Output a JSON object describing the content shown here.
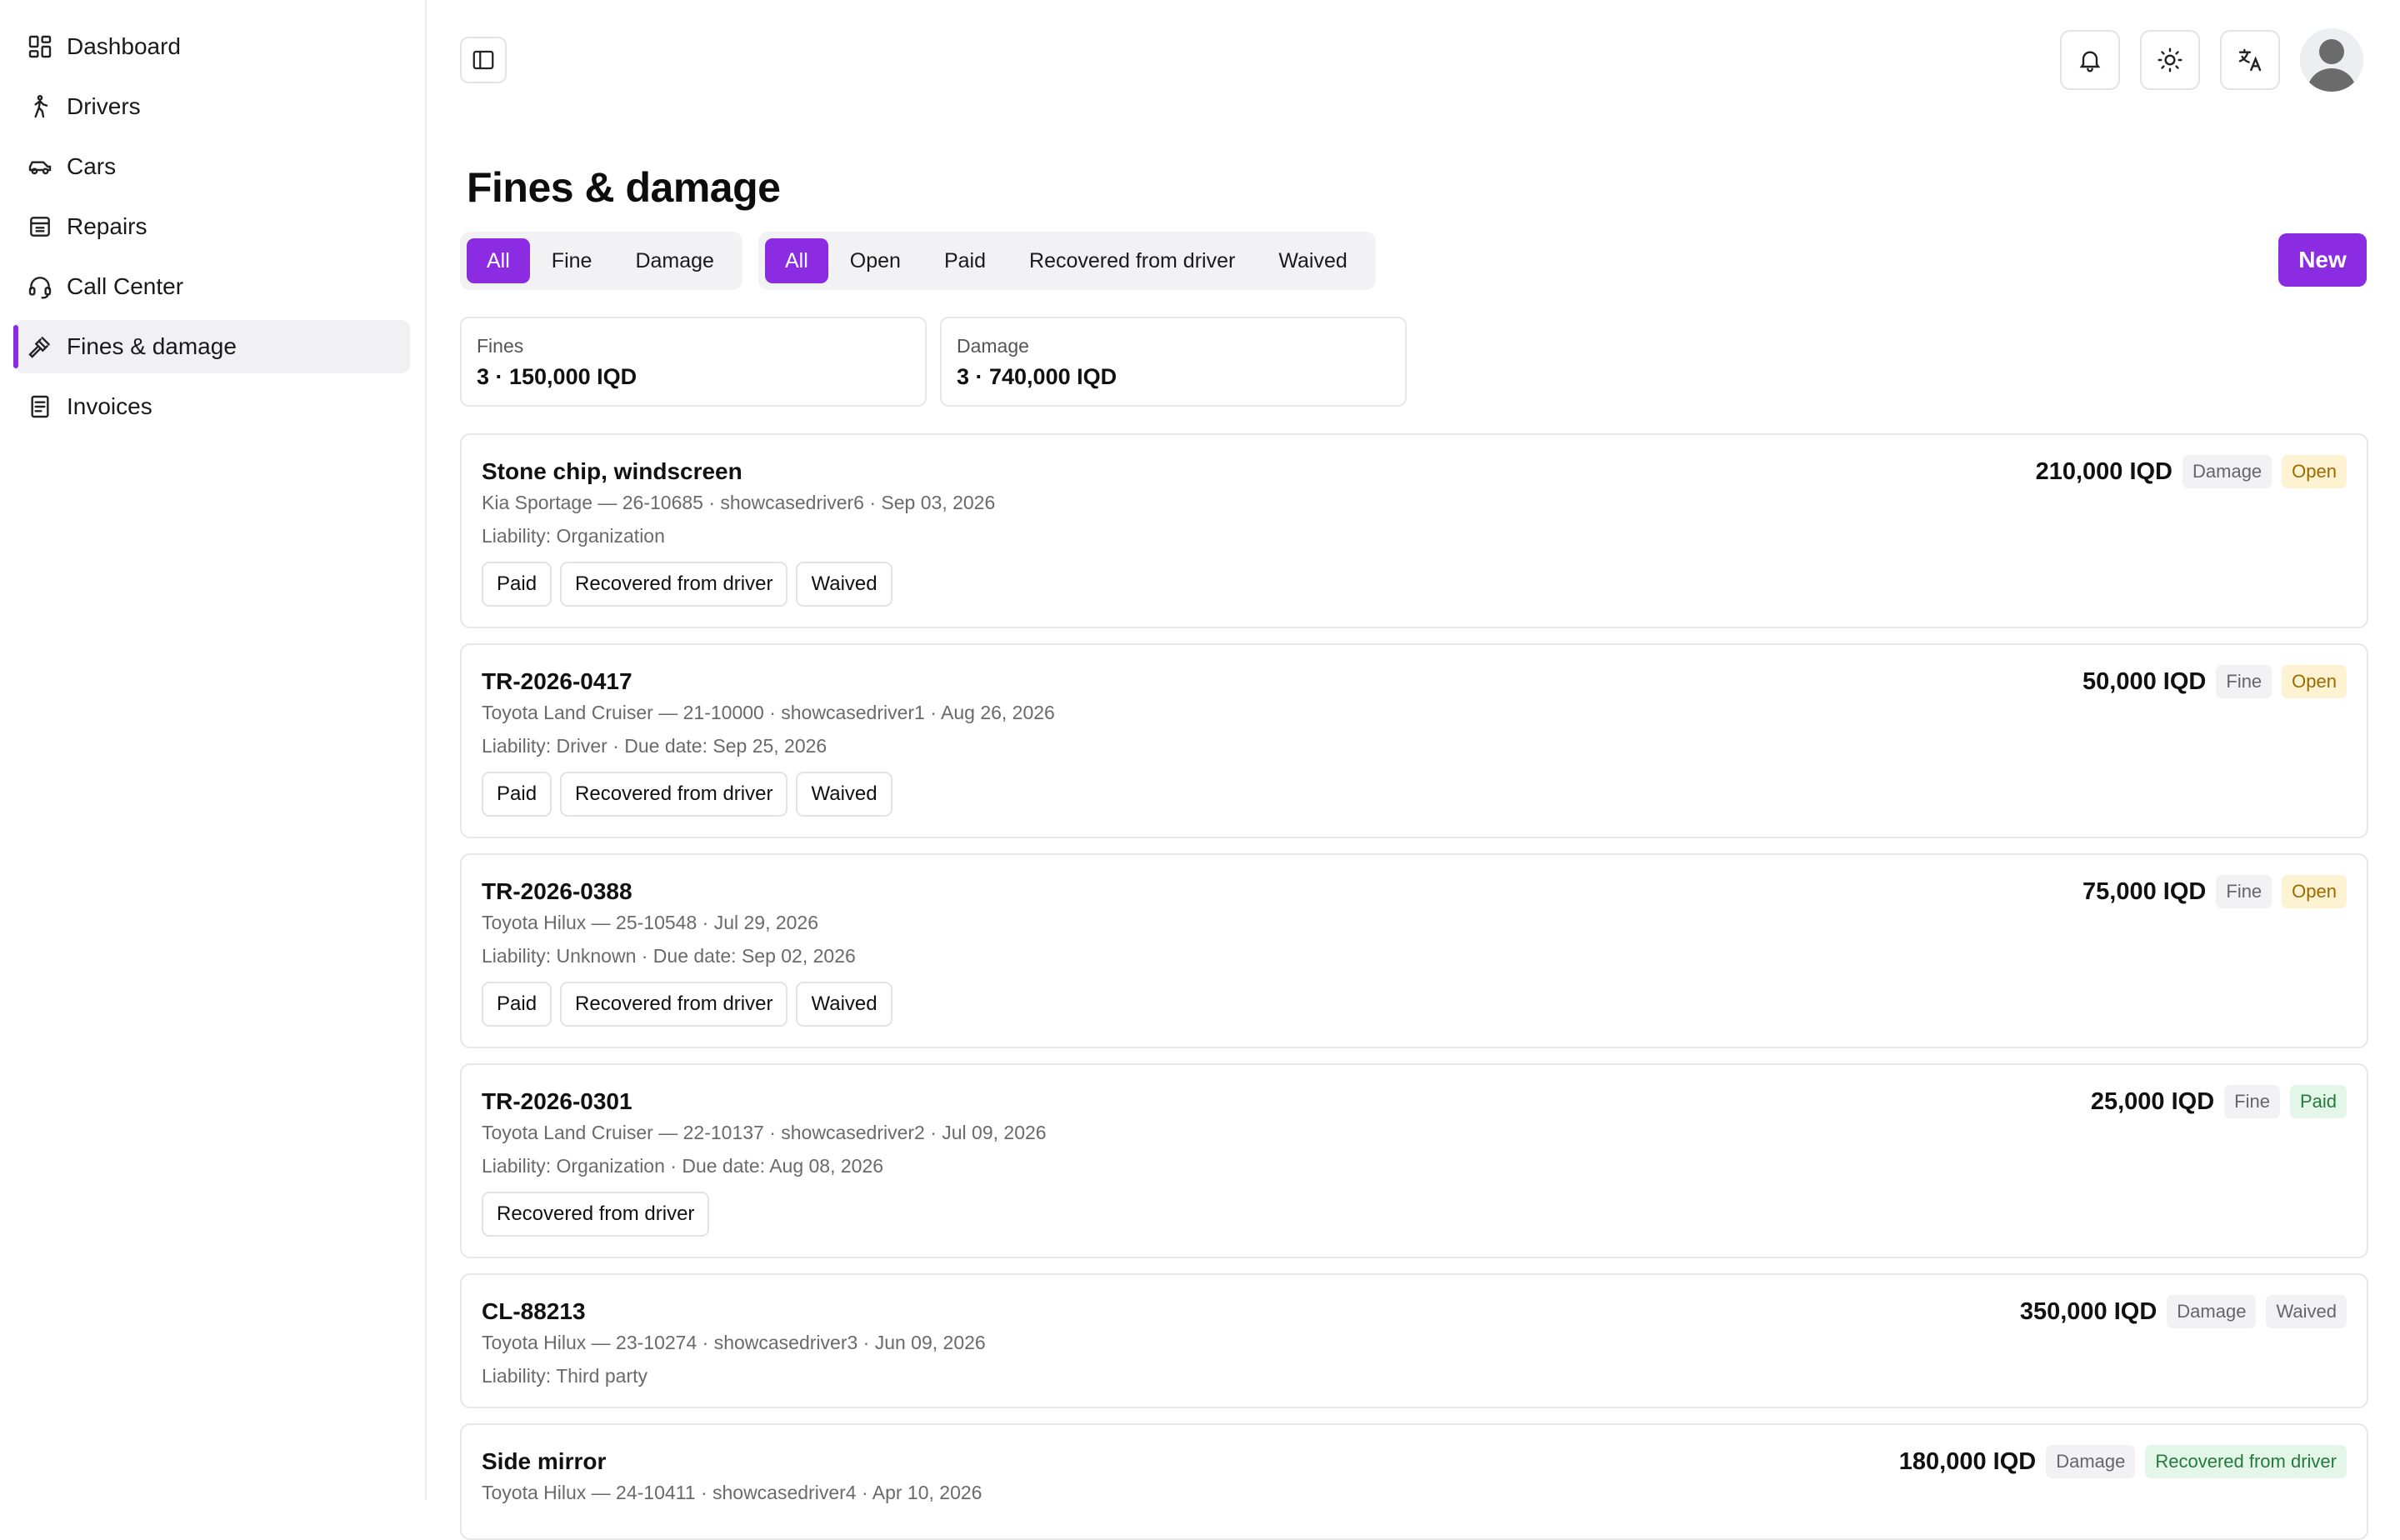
{
  "sidebar": {
    "items": [
      {
        "label": "Dashboard",
        "icon": "dashboard-icon"
      },
      {
        "label": "Drivers",
        "icon": "person-walking-icon"
      },
      {
        "label": "Cars",
        "icon": "car-icon"
      },
      {
        "label": "Repairs",
        "icon": "repairs-icon"
      },
      {
        "label": "Call Center",
        "icon": "headset-icon"
      },
      {
        "label": "Fines & damage",
        "icon": "gavel-icon",
        "active": true
      },
      {
        "label": "Invoices",
        "icon": "invoice-icon"
      }
    ]
  },
  "header": {
    "icons": [
      "sidebar-toggle-icon",
      "bell-icon",
      "sun-icon",
      "translate-icon",
      "avatar"
    ]
  },
  "page": {
    "title": "Fines & damage",
    "new_label": "New"
  },
  "filters": {
    "type": [
      "All",
      "Fine",
      "Damage"
    ],
    "status": [
      "All",
      "Open",
      "Paid",
      "Recovered from driver",
      "Waived"
    ]
  },
  "stats": {
    "fines": {
      "label": "Fines",
      "value": "3 · 150,000 IQD"
    },
    "damage": {
      "label": "Damage",
      "value": "3 · 740,000 IQD"
    }
  },
  "records": [
    {
      "title": "Stone chip, windscreen",
      "meta": "Kia Sportage — 26-10685 · showcasedriver6 · Sep 03, 2026",
      "liability": "Liability: Organization",
      "amount": "210,000 IQD",
      "type": "Damage",
      "status": "Open",
      "actions": [
        "Paid",
        "Recovered from driver",
        "Waived"
      ]
    },
    {
      "title": "TR-2026-0417",
      "meta": "Toyota Land Cruiser — 21-10000 · showcasedriver1 · Aug 26, 2026",
      "liability": "Liability: Driver · Due date: Sep 25, 2026",
      "amount": "50,000 IQD",
      "type": "Fine",
      "status": "Open",
      "actions": [
        "Paid",
        "Recovered from driver",
        "Waived"
      ]
    },
    {
      "title": "TR-2026-0388",
      "meta": "Toyota Hilux — 25-10548 · Jul 29, 2026",
      "liability": "Liability: Unknown · Due date: Sep 02, 2026",
      "amount": "75,000 IQD",
      "type": "Fine",
      "status": "Open",
      "actions": [
        "Paid",
        "Recovered from driver",
        "Waived"
      ]
    },
    {
      "title": "TR-2026-0301",
      "meta": "Toyota Land Cruiser — 22-10137 · showcasedriver2 · Jul 09, 2026",
      "liability": "Liability: Organization · Due date: Aug 08, 2026",
      "amount": "25,000 IQD",
      "type": "Fine",
      "status": "Paid",
      "actions": [
        "Recovered from driver"
      ]
    },
    {
      "title": "CL-88213",
      "meta": "Toyota Hilux — 23-10274 · showcasedriver3 · Jun 09, 2026",
      "liability": "Liability: Third party",
      "amount": "350,000 IQD",
      "type": "Damage",
      "status": "Waived",
      "actions": []
    },
    {
      "title": "Side mirror",
      "meta": "Toyota Hilux — 24-10411 · showcasedriver4 · Apr 10, 2026",
      "liability": "",
      "amount": "180,000 IQD",
      "type": "Damage",
      "status": "Recovered from driver",
      "actions": []
    }
  ]
}
